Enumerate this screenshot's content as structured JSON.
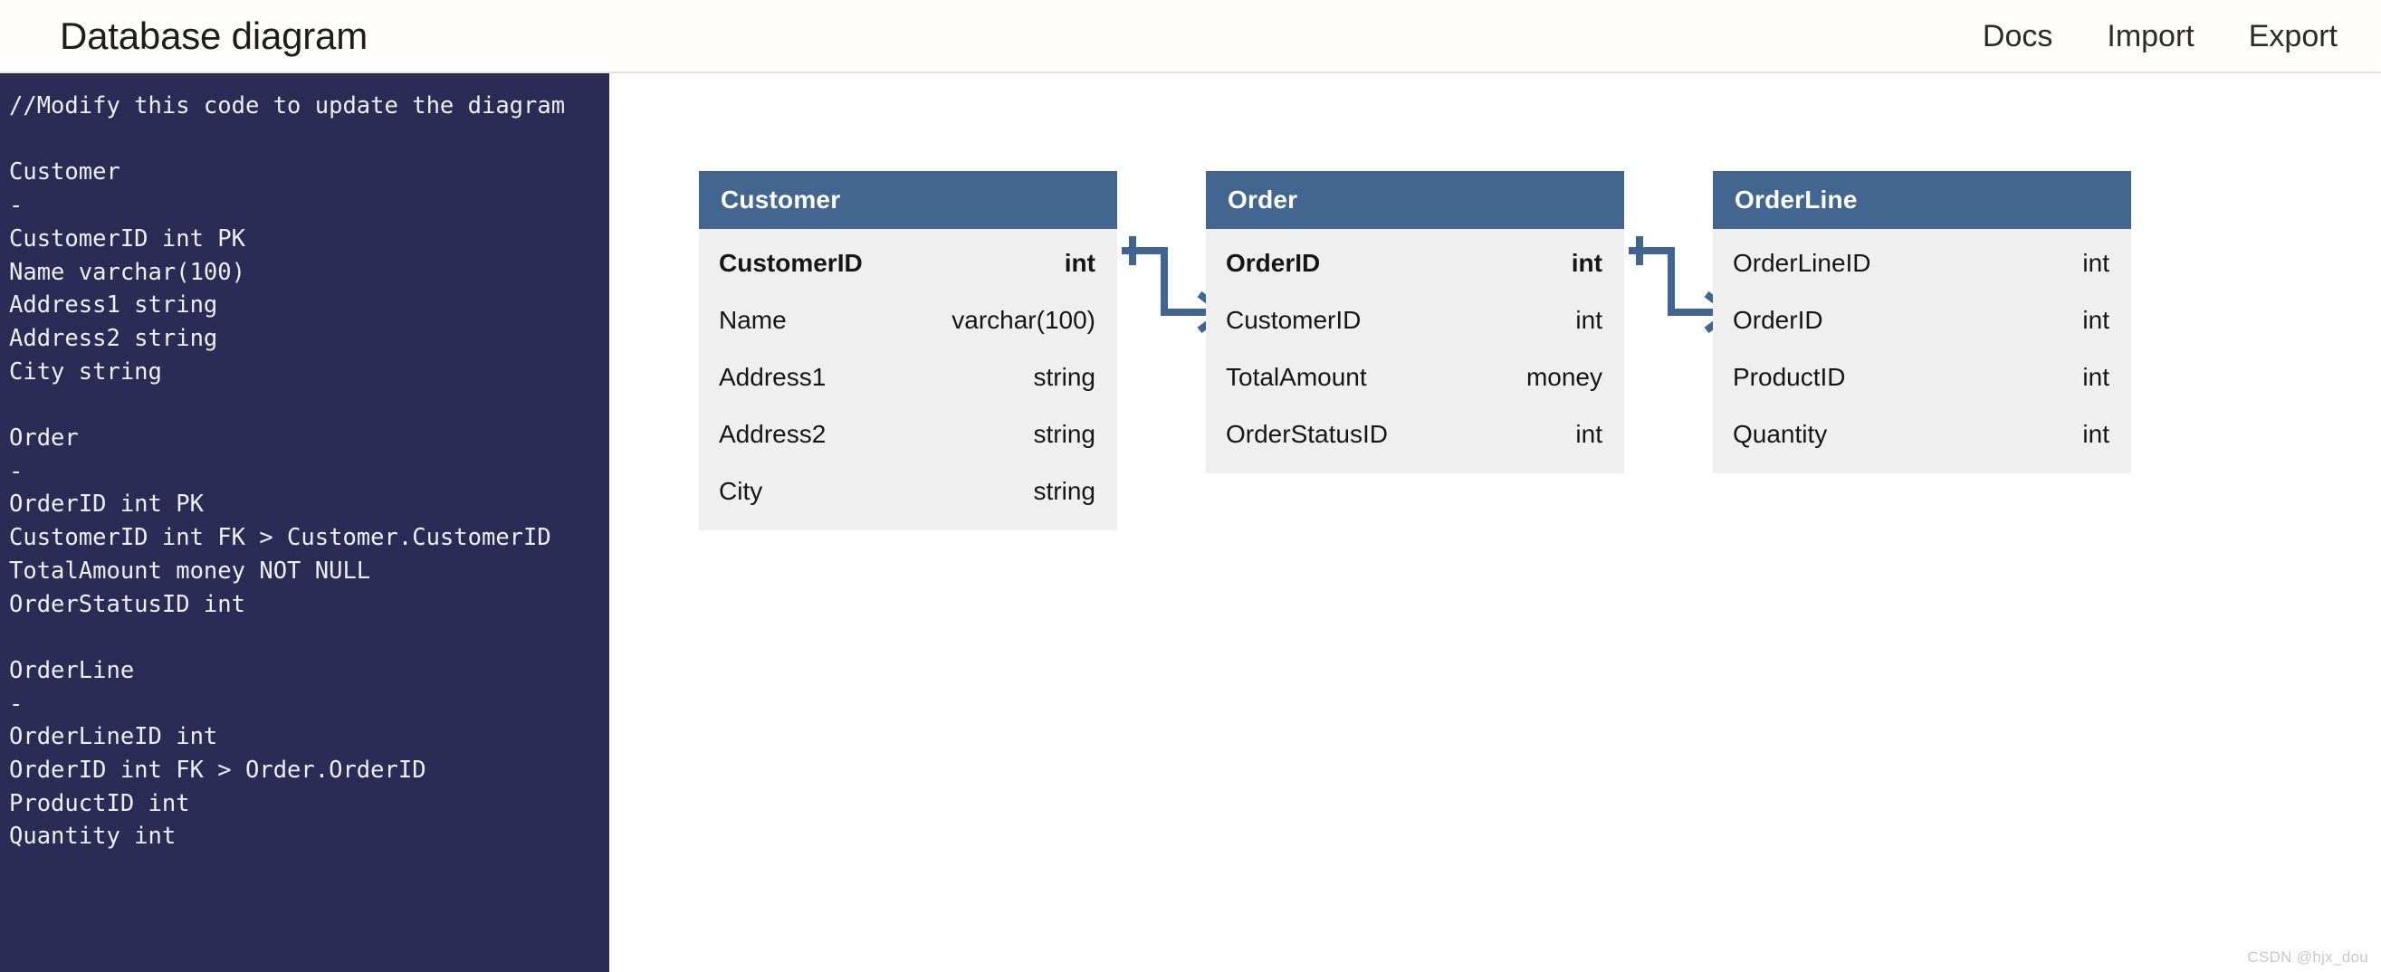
{
  "header": {
    "title": "Database diagram",
    "nav": [
      {
        "label": "Docs",
        "name": "nav-docs"
      },
      {
        "label": "Import",
        "name": "nav-import"
      },
      {
        "label": "Export",
        "name": "nav-export"
      }
    ]
  },
  "editor": {
    "code": "//Modify this code to update the diagram\n\nCustomer\n-\nCustomerID int PK\nName varchar(100)\nAddress1 string\nAddress2 string\nCity string\n\nOrder\n-\nOrderID int PK\nCustomerID int FK > Customer.CustomerID\nTotalAmount money NOT NULL\nOrderStatusID int\n\nOrderLine\n-\nOrderLineID int\nOrderID int FK > Order.OrderID\nProductID int\nQuantity int",
    "background_color": "#2b2b56",
    "text_color": "#eceff4"
  },
  "diagram": {
    "header_color": "#426690",
    "body_color": "#efefef",
    "connector_color": "#3f6590",
    "entities": [
      {
        "name": "Customer",
        "columns": [
          {
            "name": "CustomerID",
            "type": "int",
            "key": true
          },
          {
            "name": "Name",
            "type": "varchar(100)",
            "key": false
          },
          {
            "name": "Address1",
            "type": "string",
            "key": false
          },
          {
            "name": "Address2",
            "type": "string",
            "key": false
          },
          {
            "name": "City",
            "type": "string",
            "key": false
          }
        ]
      },
      {
        "name": "Order",
        "columns": [
          {
            "name": "OrderID",
            "type": "int",
            "key": true
          },
          {
            "name": "CustomerID",
            "type": "int",
            "key": false
          },
          {
            "name": "TotalAmount",
            "type": "money",
            "key": false
          },
          {
            "name": "OrderStatusID",
            "type": "int",
            "key": false
          }
        ]
      },
      {
        "name": "OrderLine",
        "columns": [
          {
            "name": "OrderLineID",
            "type": "int",
            "key": false
          },
          {
            "name": "OrderID",
            "type": "int",
            "key": false
          },
          {
            "name": "ProductID",
            "type": "int",
            "key": false
          },
          {
            "name": "Quantity",
            "type": "int",
            "key": false
          }
        ]
      }
    ],
    "relationships": [
      {
        "from": "Customer.CustomerID",
        "to": "Order.CustomerID",
        "from_cardinality": "one",
        "to_cardinality": "many"
      },
      {
        "from": "Order.OrderID",
        "to": "OrderLine.OrderID",
        "from_cardinality": "one",
        "to_cardinality": "many"
      }
    ]
  },
  "watermark": {
    "text": "CSDN @hjx_dou"
  }
}
